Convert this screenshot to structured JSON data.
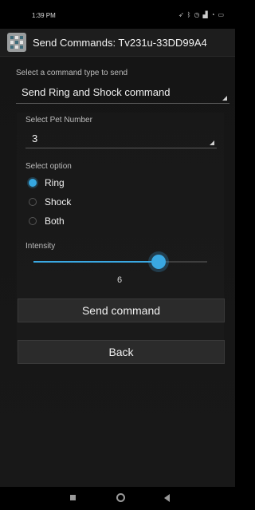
{
  "status_bar": {
    "time": "1:39 PM",
    "icons": [
      "location-icon",
      "bluetooth-icon",
      "alarm-icon",
      "signal-icon",
      "wifi-icon",
      "battery-icon"
    ]
  },
  "title_bar": {
    "title": "Send Commands: Tv231u-33DD99A4",
    "icon": "app-grid-icon"
  },
  "command_type": {
    "label": "Select a command type to send",
    "value": "Send Ring and Shock command"
  },
  "pet_number": {
    "label": "Select Pet Number",
    "value": "3"
  },
  "options": {
    "label": "Select option",
    "items": [
      {
        "label": "Ring",
        "checked": true
      },
      {
        "label": "Shock",
        "checked": false
      },
      {
        "label": "Both",
        "checked": false
      }
    ]
  },
  "intensity": {
    "label": "Intensity",
    "value": "6",
    "fraction": 0.72
  },
  "buttons": {
    "send": "Send command",
    "back": "Back"
  },
  "colors": {
    "accent": "#3aa8e2",
    "background": "#161616",
    "button": "#2b2b2b"
  }
}
